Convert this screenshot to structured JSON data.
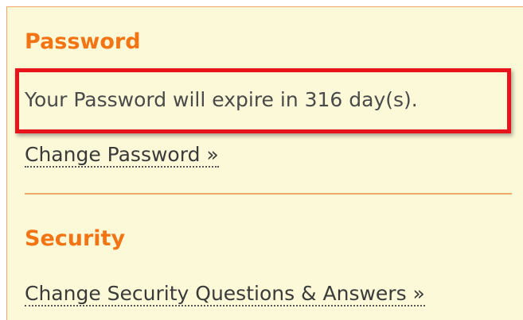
{
  "password_section": {
    "heading": "Password",
    "expiry_message": "Your Password will expire in 316 day(s).",
    "change_link": "Change Password »"
  },
  "security_section": {
    "heading": "Security",
    "change_link": "Change Security Questions & Answers »"
  },
  "colors": {
    "panel_background": "#fcf9d8",
    "heading": "#f27414",
    "highlight_border": "#e8141c",
    "divider": "#f0a868"
  }
}
